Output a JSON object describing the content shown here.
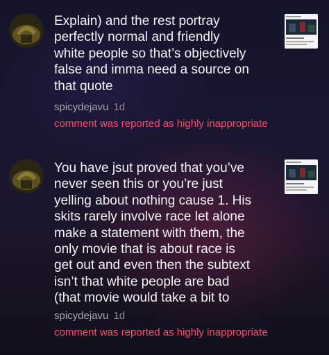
{
  "comments": [
    {
      "text": "Explain) and the rest portray\nperfectly normal and friendly\nwhite people so that’s objectively\nfalse and imma need a source on\nthat quote",
      "username": "spicydejavu",
      "time": "1d",
      "report_notice": "comment was reported as highly inappropriate"
    },
    {
      "text": "You have jsut proved that you’ve\nnever seen this or you’re just\nyelling about nothing cause 1. His\nskits rarely involve race let alone\nmake a statement with them, the\nonly movie that is about race is\nget out and even then the subtext\nisn’t that white people are bad\n(that movie would take a bit to",
      "username": "spicydejavu",
      "time": "1d",
      "report_notice": "comment was reported as highly inappropriate"
    }
  ],
  "colors": {
    "report": "#ff4d6d",
    "text": "#f4f4f6",
    "meta": "#a7a7b0"
  },
  "icons": {
    "avatar": "profile-avatar",
    "thumbnail": "post-thumbnail"
  }
}
